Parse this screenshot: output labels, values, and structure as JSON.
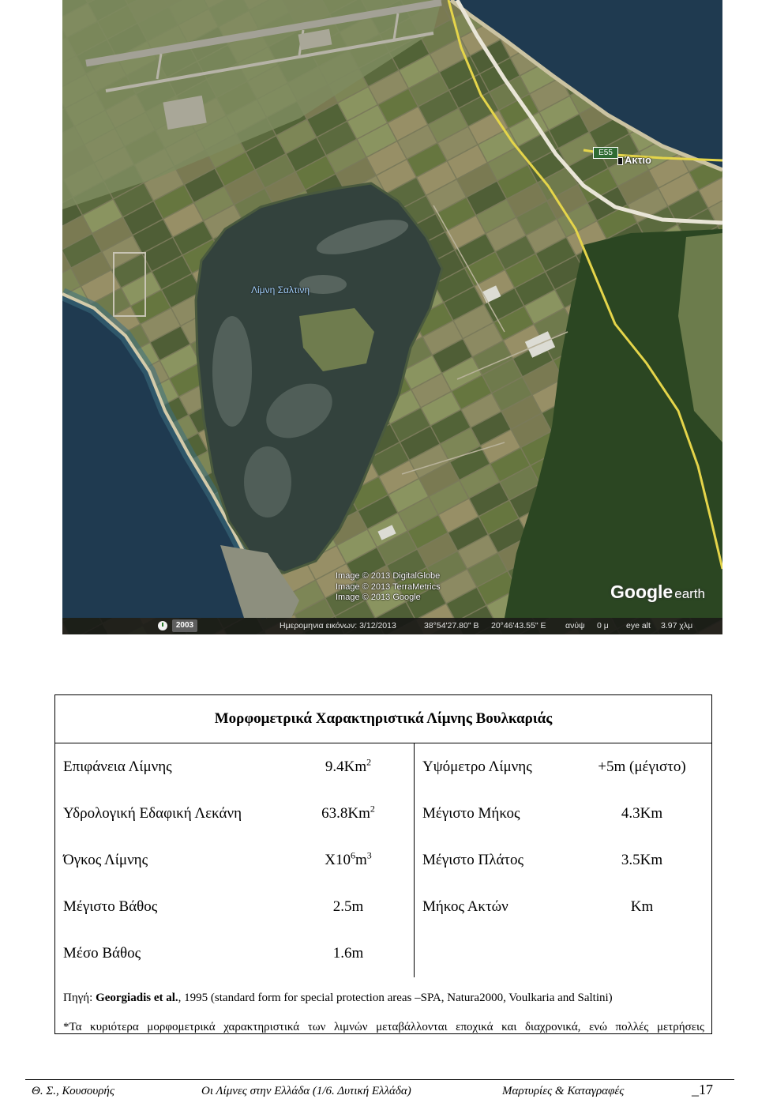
{
  "satellite": {
    "lake_label": "Λίμνη Σαλτινη",
    "town_label": "Άκτιο",
    "road_sign": "E55",
    "credits": [
      "Image © 2013 DigitalGlobe",
      "Image © 2013 TerraMetrics",
      "Image © 2013 Google"
    ],
    "logo": {
      "brand": "Google",
      "product": "earth"
    },
    "status_bar": {
      "year_badge": "2003",
      "date": "Ημερομηνια εικόνων: 3/12/2013",
      "lat": "38°54'27.80\" Β",
      "lon": "20°46'43.55\" Ε",
      "elev_label": "ανύψ",
      "elev": "0 μ",
      "eye_alt_label": "eye alt",
      "eye_alt": "3.97 χλμ"
    },
    "icons": [
      "clock-icon",
      "place-marker-icon"
    ],
    "colors": {
      "sea": "#1f3a50",
      "lake": "#33423d",
      "forest": "#2b4622",
      "road": "#e5d54a"
    }
  },
  "table": {
    "title": "Μορφομετρικά Χαρακτηριστικά Λίμνης Βουλκαριάς",
    "rows": [
      {
        "left_label": "Επιφάνεια Λίμνης",
        "left_value": "9.4Km",
        "left_sup": "2",
        "right_label": "Υψόμετρο Λίμνης",
        "right_value": "+5m (μέγιστο)"
      },
      {
        "left_label": "Υδρολογική Εδαφική Λεκάνη",
        "left_value": "63.8Km",
        "left_sup": "2",
        "right_label": "Μέγιστο Μήκος",
        "right_value": "4.3Km"
      },
      {
        "left_label": "Όγκος Λίμνης",
        "left_value": "X10",
        "left_sup": "6",
        "left_value_b": "m",
        "left_sup_b": "3",
        "right_label": "Μέγιστο Πλάτος",
        "right_value": "3.5Km"
      },
      {
        "left_label": "Μέγιστο Βάθος",
        "left_value": "2.5m",
        "right_label": "Μήκος Ακτών",
        "right_value": "Km"
      },
      {
        "left_label": "Μέσο Βάθος",
        "left_value": "1.6m"
      }
    ],
    "source_prefix": "Πηγή: ",
    "source_authors": "Georgiadis et al.",
    "source_rest": ", 1995 (standard form for special protection areas –SPA, Natura2000, Voulkaria and Saltini)",
    "note": "*Τα κυριότερα μορφομετρικά χαρακτηριστικά των λιμνών μεταβάλλονται εποχικά και διαχρονικά, ενώ πολλές μετρήσεις"
  },
  "footer": {
    "author": "Θ. Σ., Κουσουρής",
    "book": "Οι Λίμνες στην Ελλάδα (1/6. Δυτική Ελλάδα)",
    "series": "Μαρτυρίες & Καταγραφές",
    "page": "_17"
  }
}
